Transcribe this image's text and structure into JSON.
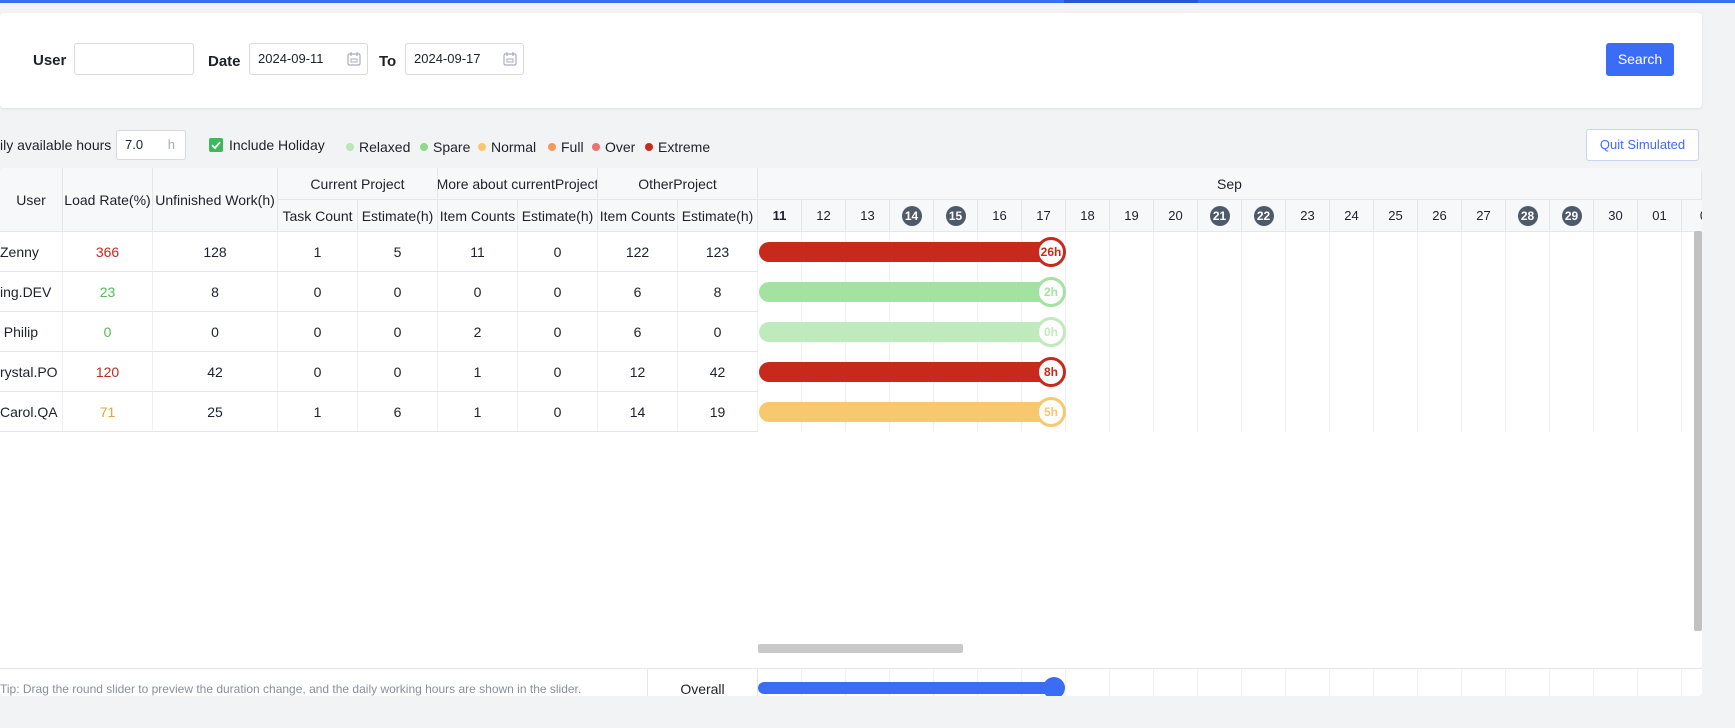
{
  "filters": {
    "user_label": "User",
    "user_value": "",
    "date_label": "Date",
    "date_from": "2024-09-11",
    "to_label": "To",
    "date_to": "2024-09-17",
    "search_label": "Search"
  },
  "options": {
    "hours_label": "ily available hours",
    "hours_value": "7.0",
    "hours_unit": "h",
    "include_holiday_label": "Include Holiday",
    "include_holiday_checked": true,
    "quit_simulated_label": "Quit Simulated",
    "legend": [
      {
        "label": "Relaxed",
        "color": "#b8e8b4"
      },
      {
        "label": "Spare",
        "color": "#8ed98a"
      },
      {
        "label": "Normal",
        "color": "#f7c86e"
      },
      {
        "label": "Full",
        "color": "#f29a5c"
      },
      {
        "label": "Over",
        "color": "#ef7070"
      },
      {
        "label": "Extreme",
        "color": "#c72a1c"
      }
    ]
  },
  "table": {
    "headers": {
      "user": "User",
      "load_rate": "Load Rate(%)",
      "unfinished": "Unfinished Work(h)",
      "current_project": "Current Project",
      "more_about": "More about currentProject",
      "other_project": "OtherProject",
      "task_count": "Task Count",
      "estimate": "Estimate(h)",
      "item_counts": "Item Counts"
    },
    "month": "Sep",
    "days": [
      {
        "label": "11",
        "weekend": false,
        "today": true
      },
      {
        "label": "12",
        "weekend": false
      },
      {
        "label": "13",
        "weekend": false
      },
      {
        "label": "14",
        "weekend": true
      },
      {
        "label": "15",
        "weekend": true
      },
      {
        "label": "16",
        "weekend": false
      },
      {
        "label": "17",
        "weekend": false
      },
      {
        "label": "18",
        "weekend": false
      },
      {
        "label": "19",
        "weekend": false
      },
      {
        "label": "20",
        "weekend": false
      },
      {
        "label": "21",
        "weekend": true
      },
      {
        "label": "22",
        "weekend": true
      },
      {
        "label": "23",
        "weekend": false
      },
      {
        "label": "24",
        "weekend": false
      },
      {
        "label": "25",
        "weekend": false
      },
      {
        "label": "26",
        "weekend": false
      },
      {
        "label": "27",
        "weekend": false
      },
      {
        "label": "28",
        "weekend": true
      },
      {
        "label": "29",
        "weekend": true
      },
      {
        "label": "30",
        "weekend": false
      },
      {
        "label": "01",
        "weekend": false
      },
      {
        "label": "0",
        "weekend": false
      }
    ],
    "rows": [
      {
        "user": "Zenny",
        "load_rate": "366",
        "rate_color": "#c72a1c",
        "unfinished": "128",
        "cur_task": "1",
        "cur_est": "5",
        "more_items": "11",
        "more_est": "0",
        "other_items": "122",
        "other_est": "123",
        "bar_color": "#c72a1c",
        "bar_label": "26h",
        "knob_text": "#c72a1c"
      },
      {
        "user": "ing.DEV",
        "load_rate": "23",
        "rate_color": "#4cc14f",
        "unfinished": "8",
        "cur_task": "0",
        "cur_est": "0",
        "more_items": "0",
        "more_est": "0",
        "other_items": "6",
        "other_est": "8",
        "bar_color": "#a3e2a0",
        "bar_label": "2h",
        "knob_text": "#a3e2a0"
      },
      {
        "user": "Philip",
        "load_rate": "0",
        "rate_color": "#4cc14f",
        "unfinished": "0",
        "cur_task": "0",
        "cur_est": "0",
        "more_items": "2",
        "more_est": "0",
        "other_items": "6",
        "other_est": "0",
        "bar_color": "#bfeabc",
        "bar_label": "0h",
        "knob_text": "#bfeabc"
      },
      {
        "user": "rystal.PO",
        "load_rate": "120",
        "rate_color": "#c72a1c",
        "unfinished": "42",
        "cur_task": "0",
        "cur_est": "0",
        "more_items": "1",
        "more_est": "0",
        "other_items": "12",
        "other_est": "42",
        "bar_color": "#c72a1c",
        "bar_label": "8h",
        "knob_text": "#c72a1c"
      },
      {
        "user": "Carol.QA",
        "load_rate": "71",
        "rate_color": "#e0a53a",
        "unfinished": "25",
        "cur_task": "1",
        "cur_est": "6",
        "more_items": "1",
        "more_est": "0",
        "other_items": "14",
        "other_est": "19",
        "bar_color": "#f7c86e",
        "bar_label": "5h",
        "knob_text": "#f7c86e"
      }
    ],
    "footer_tip": "Tip: Drag the round slider to preview the duration change, and the daily working hours are shown in the slider.",
    "footer_overall": "Overall"
  }
}
